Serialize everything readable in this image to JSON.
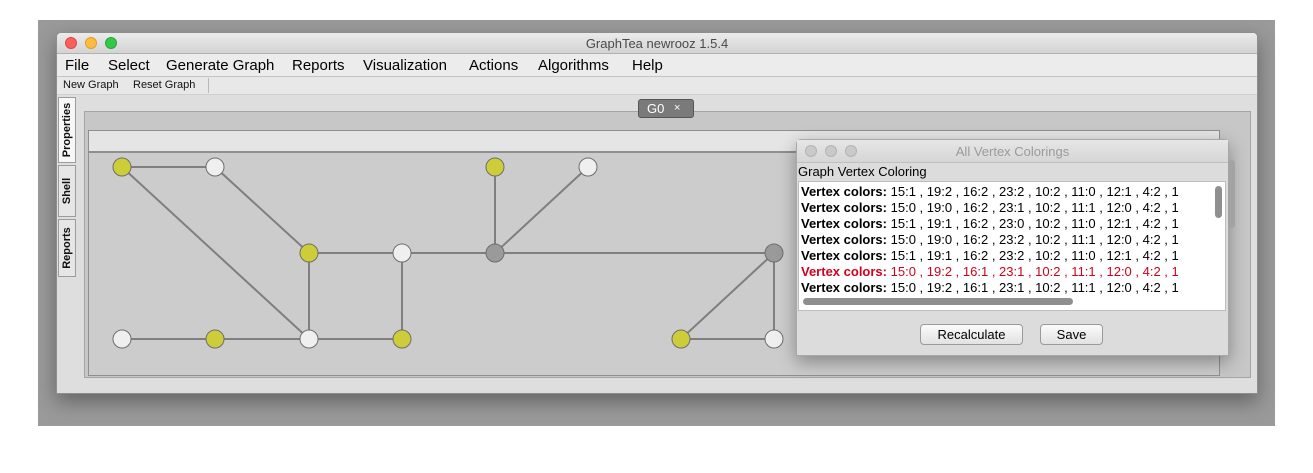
{
  "window": {
    "title": "GraphTea newrooz 1.5.4"
  },
  "menubar": {
    "items": [
      {
        "label": "File"
      },
      {
        "label": "Select"
      },
      {
        "label": "Generate Graph"
      },
      {
        "label": "Reports"
      },
      {
        "label": "Visualization"
      },
      {
        "label": "Actions"
      },
      {
        "label": "Algorithms"
      },
      {
        "label": "Help"
      }
    ]
  },
  "toolbar": {
    "new_graph": "New Graph",
    "reset_graph": "Reset Graph"
  },
  "side_tabs": [
    {
      "label": "Properties"
    },
    {
      "label": "Shell"
    },
    {
      "label": "Reports"
    }
  ],
  "doc_tab": {
    "label": "G0",
    "close": "×"
  },
  "graph": {
    "colors": {
      "yellow": "#cdcd3a",
      "white": "#efefef",
      "gray": "#9a9a9a",
      "edge": "#7f7f7f"
    },
    "vertices": [
      {
        "id": "a1",
        "color": "yellow"
      },
      {
        "id": "a2",
        "color": "white"
      },
      {
        "id": "a3",
        "color": "yellow"
      },
      {
        "id": "a4",
        "color": "white"
      },
      {
        "id": "a5",
        "color": "white"
      },
      {
        "id": "a6",
        "color": "yellow"
      },
      {
        "id": "a7",
        "color": "white"
      },
      {
        "id": "a8",
        "color": "yellow"
      },
      {
        "id": "b1",
        "color": "yellow"
      },
      {
        "id": "b2",
        "color": "white"
      },
      {
        "id": "b3",
        "color": "gray"
      },
      {
        "id": "b4",
        "color": "gray"
      },
      {
        "id": "b5",
        "color": "yellow"
      },
      {
        "id": "b6",
        "color": "white"
      }
    ],
    "edges": [
      [
        "a1",
        "a2"
      ],
      [
        "a1",
        "a7"
      ],
      [
        "a2",
        "a3"
      ],
      [
        "a3",
        "a4"
      ],
      [
        "a3",
        "a7"
      ],
      [
        "a4",
        "a8"
      ],
      [
        "a4",
        "b3"
      ],
      [
        "a5",
        "a6"
      ],
      [
        "a6",
        "a7"
      ],
      [
        "a7",
        "a8"
      ],
      [
        "b1",
        "b3"
      ],
      [
        "b2",
        "b3"
      ],
      [
        "b3",
        "b4"
      ],
      [
        "b4",
        "b5"
      ],
      [
        "b4",
        "b6"
      ],
      [
        "b5",
        "b6"
      ]
    ]
  },
  "dialog": {
    "title": "All Vertex Colorings",
    "heading": "Graph Vertex Coloring",
    "rows": [
      {
        "prefix": "Vertex colors:",
        "text": "15:1 , 19:2 , 16:2 , 23:2 , 10:2 , 11:0 , 12:1 , 4:2 , 1",
        "selected": false
      },
      {
        "prefix": "Vertex colors:",
        "text": "15:0 , 19:0 , 16:2 , 23:1 , 10:2 , 11:1 , 12:0 , 4:2 , 1",
        "selected": false
      },
      {
        "prefix": "Vertex colors:",
        "text": "15:1 , 19:1 , 16:2 , 23:0 , 10:2 , 11:0 , 12:1 , 4:2 , 1",
        "selected": false
      },
      {
        "prefix": "Vertex colors:",
        "text": "15:0 , 19:0 , 16:2 , 23:2 , 10:2 , 11:1 , 12:0 , 4:2 , 1",
        "selected": false
      },
      {
        "prefix": "Vertex colors:",
        "text": "15:1 , 19:1 , 16:2 , 23:2 , 10:2 , 11:0 , 12:1 , 4:2 , 1",
        "selected": false
      },
      {
        "prefix": "Vertex colors:",
        "text": "15:0 , 19:2 , 16:1 , 23:1 , 10:2 , 11:1 , 12:0 , 4:2 , 1",
        "selected": true
      },
      {
        "prefix": "Vertex colors:",
        "text": "15:0 , 19:2 , 16:1 , 23:1 , 10:2 , 11:1 , 12:0 , 4:2 , 1",
        "selected": false
      }
    ],
    "recalculate": "Recalculate",
    "save": "Save"
  }
}
